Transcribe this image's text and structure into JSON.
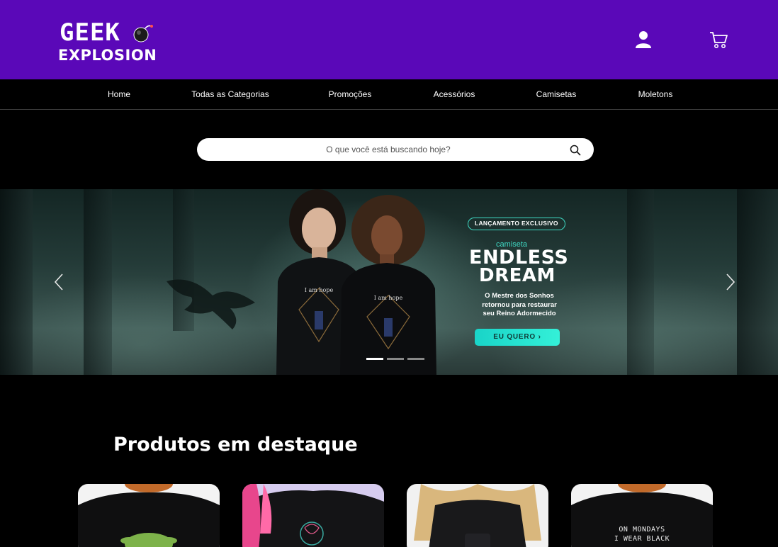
{
  "header": {
    "logo": {
      "line1": "GEEK",
      "line2": "EXPLOSION"
    },
    "icons": {
      "user": "user-icon",
      "cart": "cart-icon"
    },
    "colors": {
      "brand": "#5a08b8",
      "background": "#000000"
    }
  },
  "nav": {
    "items": [
      {
        "label": "Home"
      },
      {
        "label": "Todas as Categorias"
      },
      {
        "label": "Promoções"
      },
      {
        "label": "Acessórios"
      },
      {
        "label": "Camisetas"
      },
      {
        "label": "Moletons"
      }
    ]
  },
  "search": {
    "placeholder": "O que você está buscando hoje?",
    "value": "",
    "icon": "search-icon"
  },
  "banner": {
    "badge": "LANÇAMENTO EXCLUSIVO",
    "kicker": "camiseta",
    "title_line1": "ENDLESS",
    "title_line2": "DREAM",
    "subtitle_line1": "O Mestre dos Sonhos",
    "subtitle_line2": "retornou para restaurar",
    "subtitle_line3": "seu Reino Adormecido",
    "cta": "EU QUERO  ›",
    "shirt_print": "I am hope",
    "slides_count": 3,
    "active_slide": 1,
    "accent_color": "#2fe3d0"
  },
  "featured": {
    "title": "Produtos em destaque",
    "products": [
      {
        "image": "black-tshirt-green-print"
      },
      {
        "image": "black-hoodie-pink-hair"
      },
      {
        "image": "black-backpack-blonde"
      },
      {
        "image": "black-tshirt-text-print",
        "print_line1": "ON MONDAYS",
        "print_line2": "I WEAR BLACK"
      }
    ]
  }
}
